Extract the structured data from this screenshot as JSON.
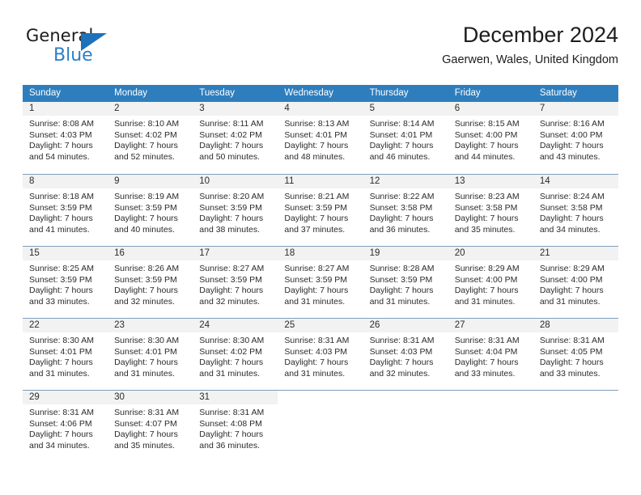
{
  "logo": {
    "word_one": "General",
    "word_two": "Blue",
    "triangle_color": "#1e72bb",
    "blue_color": "#2a7fc9"
  },
  "header": {
    "title": "December 2024",
    "location": "Gaerwen, Wales, United Kingdom"
  },
  "colors": {
    "header_row_bg": "#2e7ebd",
    "header_row_text": "#ffffff",
    "day_number_bg": "#f2f2f2",
    "row_divider": "#7f9db9",
    "body_text": "#2b2b2b"
  },
  "weekdays": [
    "Sunday",
    "Monday",
    "Tuesday",
    "Wednesday",
    "Thursday",
    "Friday",
    "Saturday"
  ],
  "weeks": [
    [
      {
        "day": "1",
        "sunrise": "Sunrise: 8:08 AM",
        "sunset": "Sunset: 4:03 PM",
        "daylight_1": "Daylight: 7 hours",
        "daylight_2": "and 54 minutes."
      },
      {
        "day": "2",
        "sunrise": "Sunrise: 8:10 AM",
        "sunset": "Sunset: 4:02 PM",
        "daylight_1": "Daylight: 7 hours",
        "daylight_2": "and 52 minutes."
      },
      {
        "day": "3",
        "sunrise": "Sunrise: 8:11 AM",
        "sunset": "Sunset: 4:02 PM",
        "daylight_1": "Daylight: 7 hours",
        "daylight_2": "and 50 minutes."
      },
      {
        "day": "4",
        "sunrise": "Sunrise: 8:13 AM",
        "sunset": "Sunset: 4:01 PM",
        "daylight_1": "Daylight: 7 hours",
        "daylight_2": "and 48 minutes."
      },
      {
        "day": "5",
        "sunrise": "Sunrise: 8:14 AM",
        "sunset": "Sunset: 4:01 PM",
        "daylight_1": "Daylight: 7 hours",
        "daylight_2": "and 46 minutes."
      },
      {
        "day": "6",
        "sunrise": "Sunrise: 8:15 AM",
        "sunset": "Sunset: 4:00 PM",
        "daylight_1": "Daylight: 7 hours",
        "daylight_2": "and 44 minutes."
      },
      {
        "day": "7",
        "sunrise": "Sunrise: 8:16 AM",
        "sunset": "Sunset: 4:00 PM",
        "daylight_1": "Daylight: 7 hours",
        "daylight_2": "and 43 minutes."
      }
    ],
    [
      {
        "day": "8",
        "sunrise": "Sunrise: 8:18 AM",
        "sunset": "Sunset: 3:59 PM",
        "daylight_1": "Daylight: 7 hours",
        "daylight_2": "and 41 minutes."
      },
      {
        "day": "9",
        "sunrise": "Sunrise: 8:19 AM",
        "sunset": "Sunset: 3:59 PM",
        "daylight_1": "Daylight: 7 hours",
        "daylight_2": "and 40 minutes."
      },
      {
        "day": "10",
        "sunrise": "Sunrise: 8:20 AM",
        "sunset": "Sunset: 3:59 PM",
        "daylight_1": "Daylight: 7 hours",
        "daylight_2": "and 38 minutes."
      },
      {
        "day": "11",
        "sunrise": "Sunrise: 8:21 AM",
        "sunset": "Sunset: 3:59 PM",
        "daylight_1": "Daylight: 7 hours",
        "daylight_2": "and 37 minutes."
      },
      {
        "day": "12",
        "sunrise": "Sunrise: 8:22 AM",
        "sunset": "Sunset: 3:58 PM",
        "daylight_1": "Daylight: 7 hours",
        "daylight_2": "and 36 minutes."
      },
      {
        "day": "13",
        "sunrise": "Sunrise: 8:23 AM",
        "sunset": "Sunset: 3:58 PM",
        "daylight_1": "Daylight: 7 hours",
        "daylight_2": "and 35 minutes."
      },
      {
        "day": "14",
        "sunrise": "Sunrise: 8:24 AM",
        "sunset": "Sunset: 3:58 PM",
        "daylight_1": "Daylight: 7 hours",
        "daylight_2": "and 34 minutes."
      }
    ],
    [
      {
        "day": "15",
        "sunrise": "Sunrise: 8:25 AM",
        "sunset": "Sunset: 3:59 PM",
        "daylight_1": "Daylight: 7 hours",
        "daylight_2": "and 33 minutes."
      },
      {
        "day": "16",
        "sunrise": "Sunrise: 8:26 AM",
        "sunset": "Sunset: 3:59 PM",
        "daylight_1": "Daylight: 7 hours",
        "daylight_2": "and 32 minutes."
      },
      {
        "day": "17",
        "sunrise": "Sunrise: 8:27 AM",
        "sunset": "Sunset: 3:59 PM",
        "daylight_1": "Daylight: 7 hours",
        "daylight_2": "and 32 minutes."
      },
      {
        "day": "18",
        "sunrise": "Sunrise: 8:27 AM",
        "sunset": "Sunset: 3:59 PM",
        "daylight_1": "Daylight: 7 hours",
        "daylight_2": "and 31 minutes."
      },
      {
        "day": "19",
        "sunrise": "Sunrise: 8:28 AM",
        "sunset": "Sunset: 3:59 PM",
        "daylight_1": "Daylight: 7 hours",
        "daylight_2": "and 31 minutes."
      },
      {
        "day": "20",
        "sunrise": "Sunrise: 8:29 AM",
        "sunset": "Sunset: 4:00 PM",
        "daylight_1": "Daylight: 7 hours",
        "daylight_2": "and 31 minutes."
      },
      {
        "day": "21",
        "sunrise": "Sunrise: 8:29 AM",
        "sunset": "Sunset: 4:00 PM",
        "daylight_1": "Daylight: 7 hours",
        "daylight_2": "and 31 minutes."
      }
    ],
    [
      {
        "day": "22",
        "sunrise": "Sunrise: 8:30 AM",
        "sunset": "Sunset: 4:01 PM",
        "daylight_1": "Daylight: 7 hours",
        "daylight_2": "and 31 minutes."
      },
      {
        "day": "23",
        "sunrise": "Sunrise: 8:30 AM",
        "sunset": "Sunset: 4:01 PM",
        "daylight_1": "Daylight: 7 hours",
        "daylight_2": "and 31 minutes."
      },
      {
        "day": "24",
        "sunrise": "Sunrise: 8:30 AM",
        "sunset": "Sunset: 4:02 PM",
        "daylight_1": "Daylight: 7 hours",
        "daylight_2": "and 31 minutes."
      },
      {
        "day": "25",
        "sunrise": "Sunrise: 8:31 AM",
        "sunset": "Sunset: 4:03 PM",
        "daylight_1": "Daylight: 7 hours",
        "daylight_2": "and 31 minutes."
      },
      {
        "day": "26",
        "sunrise": "Sunrise: 8:31 AM",
        "sunset": "Sunset: 4:03 PM",
        "daylight_1": "Daylight: 7 hours",
        "daylight_2": "and 32 minutes."
      },
      {
        "day": "27",
        "sunrise": "Sunrise: 8:31 AM",
        "sunset": "Sunset: 4:04 PM",
        "daylight_1": "Daylight: 7 hours",
        "daylight_2": "and 33 minutes."
      },
      {
        "day": "28",
        "sunrise": "Sunrise: 8:31 AM",
        "sunset": "Sunset: 4:05 PM",
        "daylight_1": "Daylight: 7 hours",
        "daylight_2": "and 33 minutes."
      }
    ],
    [
      {
        "day": "29",
        "sunrise": "Sunrise: 8:31 AM",
        "sunset": "Sunset: 4:06 PM",
        "daylight_1": "Daylight: 7 hours",
        "daylight_2": "and 34 minutes."
      },
      {
        "day": "30",
        "sunrise": "Sunrise: 8:31 AM",
        "sunset": "Sunset: 4:07 PM",
        "daylight_1": "Daylight: 7 hours",
        "daylight_2": "and 35 minutes."
      },
      {
        "day": "31",
        "sunrise": "Sunrise: 8:31 AM",
        "sunset": "Sunset: 4:08 PM",
        "daylight_1": "Daylight: 7 hours",
        "daylight_2": "and 36 minutes."
      },
      {
        "day": "",
        "sunrise": "",
        "sunset": "",
        "daylight_1": "",
        "daylight_2": ""
      },
      {
        "day": "",
        "sunrise": "",
        "sunset": "",
        "daylight_1": "",
        "daylight_2": ""
      },
      {
        "day": "",
        "sunrise": "",
        "sunset": "",
        "daylight_1": "",
        "daylight_2": ""
      },
      {
        "day": "",
        "sunrise": "",
        "sunset": "",
        "daylight_1": "",
        "daylight_2": ""
      }
    ]
  ]
}
